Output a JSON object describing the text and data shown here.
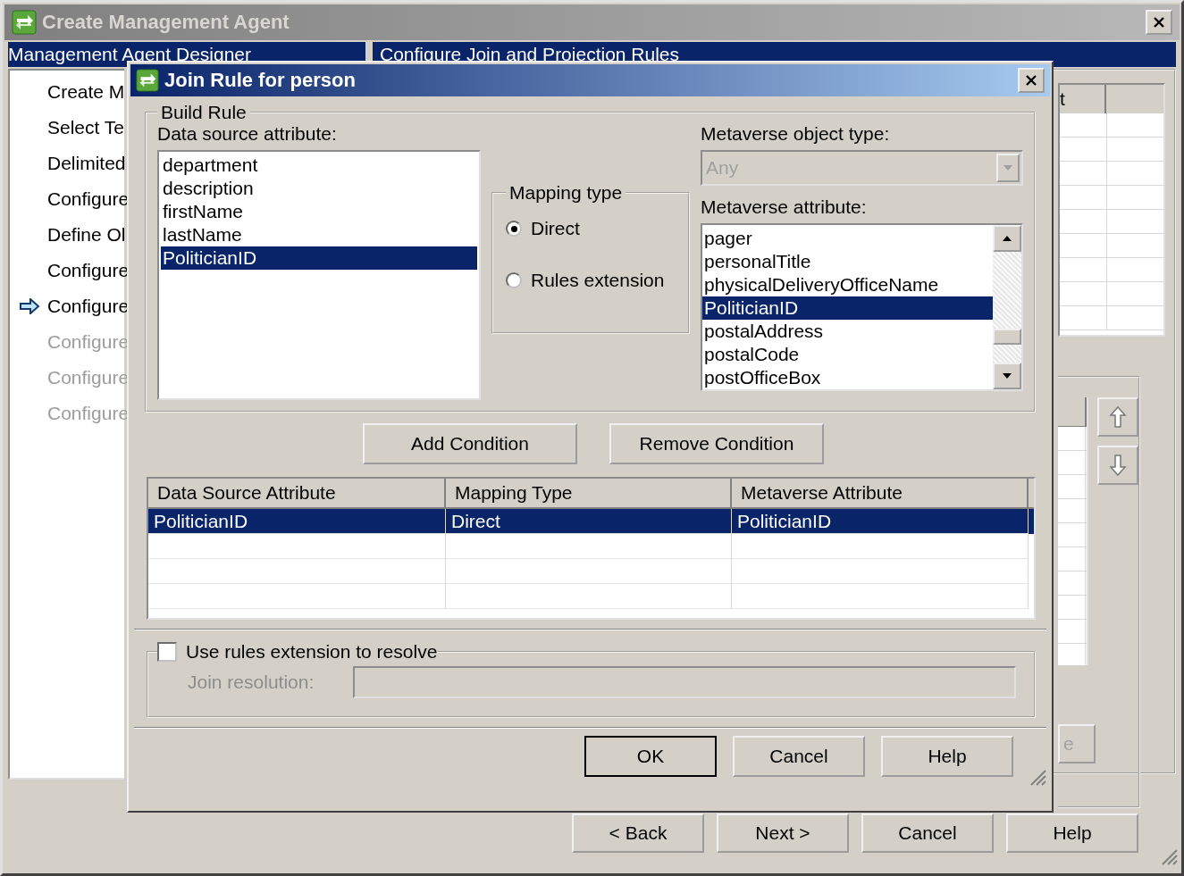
{
  "window": {
    "title": "Create Management Agent"
  },
  "header": {
    "left": "Management Agent Designer",
    "right": "Configure Join and Projection Rules"
  },
  "steps": [
    {
      "label": "Create M",
      "current": false,
      "disabled": false
    },
    {
      "label": "Select Te",
      "current": false,
      "disabled": false
    },
    {
      "label": "Delimited",
      "current": false,
      "disabled": false
    },
    {
      "label": "Configure",
      "current": false,
      "disabled": false
    },
    {
      "label": "Define Ol",
      "current": false,
      "disabled": false
    },
    {
      "label": "Configure",
      "current": false,
      "disabled": false
    },
    {
      "label": "Configure",
      "current": true,
      "disabled": false
    },
    {
      "label": "Configure",
      "current": false,
      "disabled": true
    },
    {
      "label": "Configure",
      "current": false,
      "disabled": true
    },
    {
      "label": "Configure",
      "current": false,
      "disabled": true
    }
  ],
  "background_panel": {
    "column_header": "t",
    "button_label": "e"
  },
  "wizard_buttons": [
    "< Back",
    "Next >",
    "Cancel",
    "Help"
  ],
  "dialog": {
    "title": "Join Rule for person",
    "build_rule": {
      "legend": "Build Rule",
      "source_label": "Data source attribute:",
      "source_items": [
        {
          "label": "department",
          "selected": false
        },
        {
          "label": "description",
          "selected": false
        },
        {
          "label": "firstName",
          "selected": false
        },
        {
          "label": "lastName",
          "selected": false
        },
        {
          "label": "PoliticianID",
          "selected": true
        }
      ],
      "mapping": {
        "legend": "Mapping type",
        "options": [
          {
            "label": "Direct",
            "selected": true
          },
          {
            "label": "Rules extension",
            "selected": false
          }
        ]
      },
      "object_type_label": "Metaverse object type:",
      "object_type": {
        "value": "Any",
        "disabled": true
      },
      "attribute_label": "Metaverse attribute:",
      "attribute_items": [
        {
          "label": "pager",
          "selected": false
        },
        {
          "label": "personalTitle",
          "selected": false
        },
        {
          "label": "physicalDeliveryOfficeName",
          "selected": false
        },
        {
          "label": "PoliticianID",
          "selected": true
        },
        {
          "label": "postalAddress",
          "selected": false
        },
        {
          "label": "postalCode",
          "selected": false
        },
        {
          "label": "postOfficeBox",
          "selected": false
        }
      ]
    },
    "condition_buttons": [
      "Add Condition",
      "Remove Condition"
    ],
    "conditions": {
      "columns": [
        "Data Source Attribute",
        "Mapping Type",
        "Metaverse Attribute"
      ],
      "rows": [
        {
          "cells": [
            "PoliticianID",
            "Direct",
            "PoliticianID"
          ],
          "selected": true
        }
      ]
    },
    "resolve": {
      "label": "Use rules extension to resolve",
      "checked": false,
      "field_label": "Join resolution:",
      "disabled": true
    },
    "buttons": [
      {
        "label": "OK",
        "default": true
      },
      {
        "label": "Cancel",
        "default": false
      },
      {
        "label": "Help",
        "default": false
      }
    ]
  }
}
